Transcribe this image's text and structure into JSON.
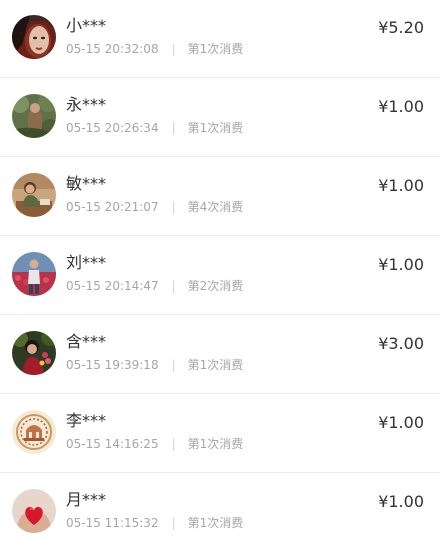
{
  "records": [
    {
      "name": "小***",
      "time": "05-15 20:32:08",
      "count": "第1次消费",
      "amount": "¥5.20",
      "avatar_icon": "woman-red-hair-portrait"
    },
    {
      "name": "永***",
      "time": "05-15 20:26:34",
      "count": "第1次消费",
      "amount": "¥1.00",
      "avatar_icon": "person-in-greenery-photo"
    },
    {
      "name": "敏***",
      "time": "05-15 20:21:07",
      "count": "第4次消费",
      "amount": "¥1.00",
      "avatar_icon": "woman-seated-indoors-photo"
    },
    {
      "name": "刘***",
      "time": "05-15 20:14:47",
      "count": "第2次消费",
      "amount": "¥1.00",
      "avatar_icon": "woman-in-flower-field-photo"
    },
    {
      "name": "含***",
      "time": "05-15 19:39:18",
      "count": "第1次消费",
      "amount": "¥3.00",
      "avatar_icon": "woman-with-flowers-photo"
    },
    {
      "name": "李***",
      "time": "05-15 14:16:25",
      "count": "第1次消费",
      "amount": "¥1.00",
      "avatar_icon": "ornate-emblem-logo"
    },
    {
      "name": "月***",
      "time": "05-15 11:15:32",
      "count": "第1次消费",
      "amount": "¥1.00",
      "avatar_icon": "hands-holding-heart-photo"
    }
  ]
}
